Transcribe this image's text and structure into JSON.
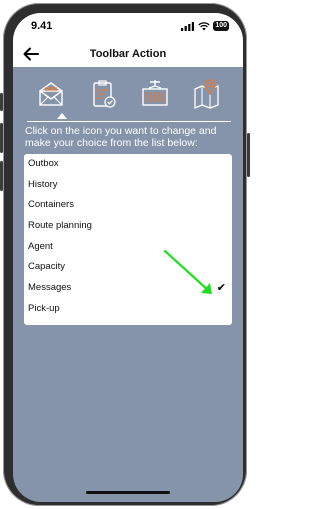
{
  "status": {
    "time": "9.41",
    "battery": "100"
  },
  "appbar": {
    "title": "Toolbar Action"
  },
  "toolbar_icons": [
    {
      "name": "envelope-icon"
    },
    {
      "name": "clipboard-check-icon"
    },
    {
      "name": "container-crane-icon"
    },
    {
      "name": "map-pin-icon"
    }
  ],
  "instruction": "Click on the icon you want to change and make your choice from the list below:",
  "list": {
    "items": [
      {
        "label": "Outbox"
      },
      {
        "label": "History"
      },
      {
        "label": "Containers"
      },
      {
        "label": "Route planning"
      },
      {
        "label": "Agent"
      },
      {
        "label": "Capacity"
      },
      {
        "label": "Messages",
        "selected": true
      },
      {
        "label": "Pick-up"
      }
    ]
  },
  "colors": {
    "background": "#8594aa",
    "icon_accent": "#e07a3a",
    "annotation_arrow": "#22dd22"
  }
}
